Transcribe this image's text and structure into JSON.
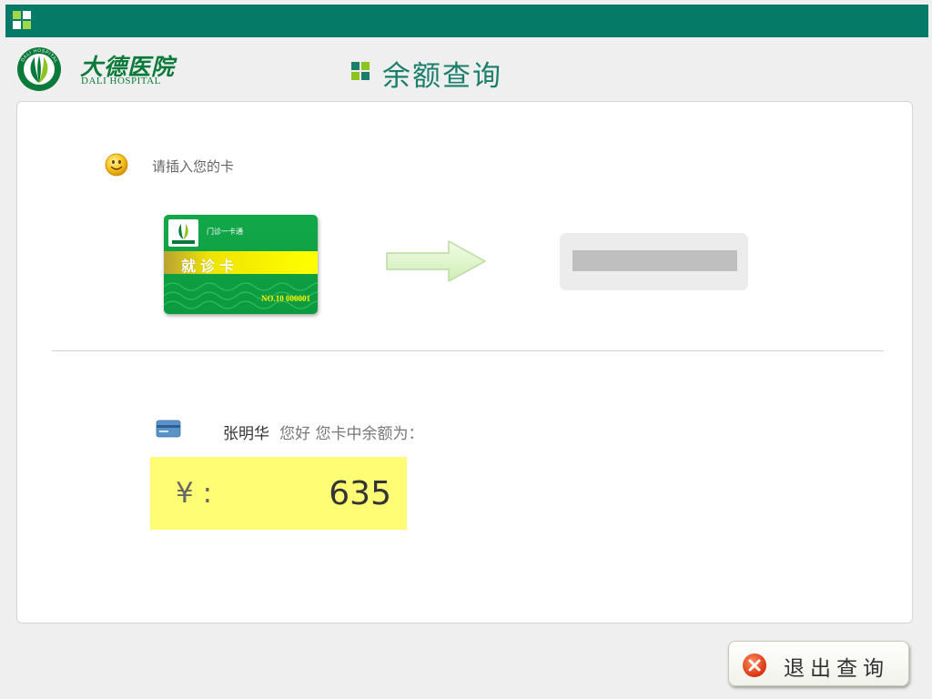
{
  "header": {
    "brand_colors": {
      "bar": "#057a67",
      "accent_green": "#8fc31f",
      "accent_dark": "#0a7a3a"
    }
  },
  "hospital": {
    "name_cn": "大德医院",
    "name_en": "DALI HOSPITAL",
    "emblem_text": "DALI HOSPITAL"
  },
  "page": {
    "title": "余额查询"
  },
  "insert_card": {
    "prompt": "请插入您的卡",
    "smiley_icon": "smiley-icon"
  },
  "card": {
    "header": "门诊一卡通",
    "title": "就诊卡",
    "number": "NO.10 000001",
    "logo_text": "大德医院"
  },
  "balance": {
    "patient_name": "张明华",
    "greeting": "您好 您卡中余额为：",
    "currency_label": "¥ :",
    "amount": "635",
    "highlight_color": "#fffd74"
  },
  "actions": {
    "exit_label": "退出查询"
  }
}
